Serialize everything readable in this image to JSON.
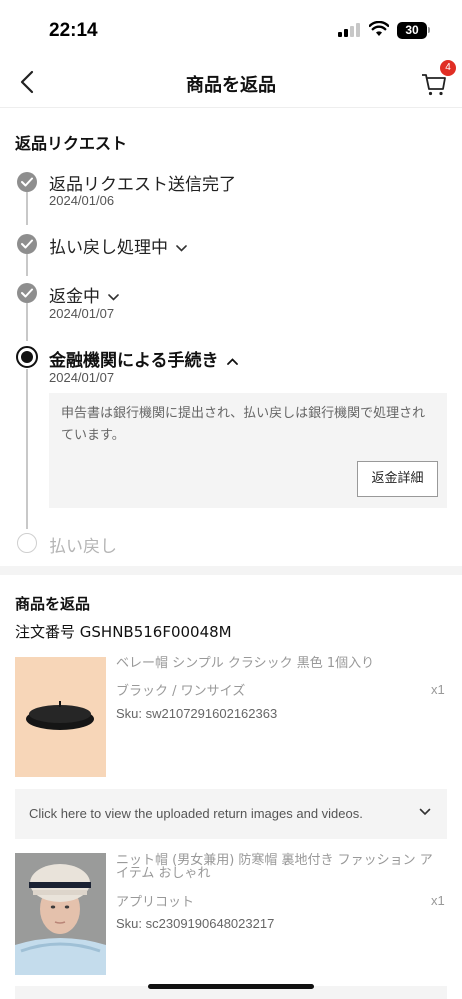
{
  "status_bar": {
    "time": "22:14",
    "battery": "30"
  },
  "header": {
    "title": "商品を返品",
    "cart_count": "4"
  },
  "timeline": {
    "section_title": "返品リクエスト",
    "steps": [
      {
        "label": "返品リクエスト送信完了",
        "date": "2024/01/06"
      },
      {
        "label": "払い戻し処理中"
      },
      {
        "label": "返金中",
        "date": "2024/01/07"
      },
      {
        "label": "金融機関による手続き",
        "date": "2024/01/07"
      },
      {
        "label": "払い戻し"
      }
    ],
    "detail_text": "申告書は銀行機関に提出され、払い戻しは銀行機関で処理されています。",
    "refund_details_button": "返金詳細"
  },
  "return_items": {
    "title": "商品を返品",
    "order_number": "注文番号 GSHNB516F00048M",
    "upload_prompt": "Click here to view the uploaded return images and videos.",
    "items": [
      {
        "name": "ベレー帽 シンプル クラシック 黒色 1個入り",
        "variant": "ブラック / ワンサイズ",
        "qty": "x1",
        "sku": "Sku: sw2107291602162363"
      },
      {
        "name": "ニット帽 (男女兼用) 防寒帽 裏地付き ファッション アイテム おしゃれ",
        "variant": "アプリコット",
        "qty": "x1",
        "sku": "Sku: sc2309190648023217"
      }
    ]
  }
}
